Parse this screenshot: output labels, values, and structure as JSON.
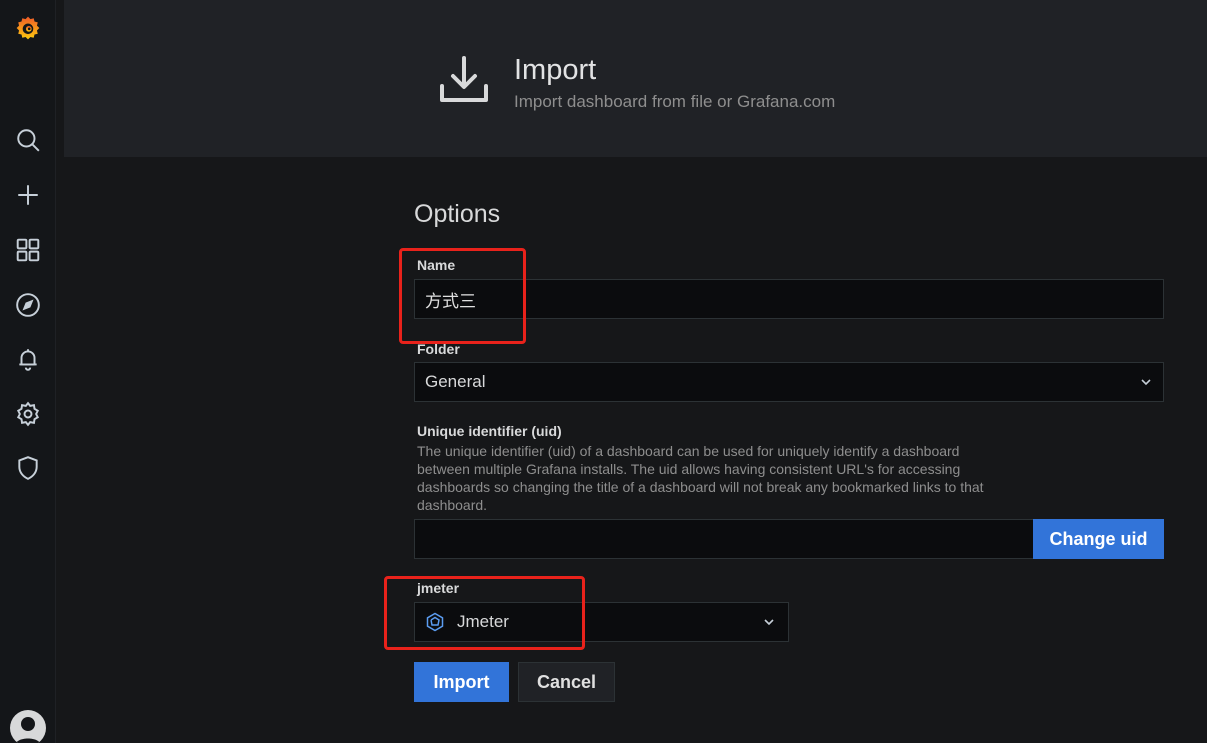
{
  "header": {
    "title": "Import",
    "subtitle": "Import dashboard from file or Grafana.com"
  },
  "sidebar": {
    "items": [
      "grafana-logo",
      "search-icon",
      "plus-icon",
      "dashboards-icon",
      "explore-icon",
      "alerting-icon",
      "settings-icon",
      "shield-icon"
    ]
  },
  "options": {
    "title": "Options",
    "name_label": "Name",
    "name_value": "方式三",
    "folder_label": "Folder",
    "folder_value": "General",
    "uid_label": "Unique identifier (uid)",
    "uid_description": "The unique identifier (uid) of a dashboard can be used for uniquely identify a dashboard between multiple Grafana installs. The uid allows having consistent URL's for accessing dashboards so changing the title of a dashboard will not break any bookmarked links to that dashboard.",
    "uid_value": "",
    "change_uid_label": "Change uid",
    "datasource_label": "jmeter",
    "datasource_value": "Jmeter"
  },
  "actions": {
    "import_label": "Import",
    "cancel_label": "Cancel"
  },
  "colors": {
    "primary": "#3274d9",
    "highlight": "#e8221b",
    "logo": "#f05a28"
  }
}
